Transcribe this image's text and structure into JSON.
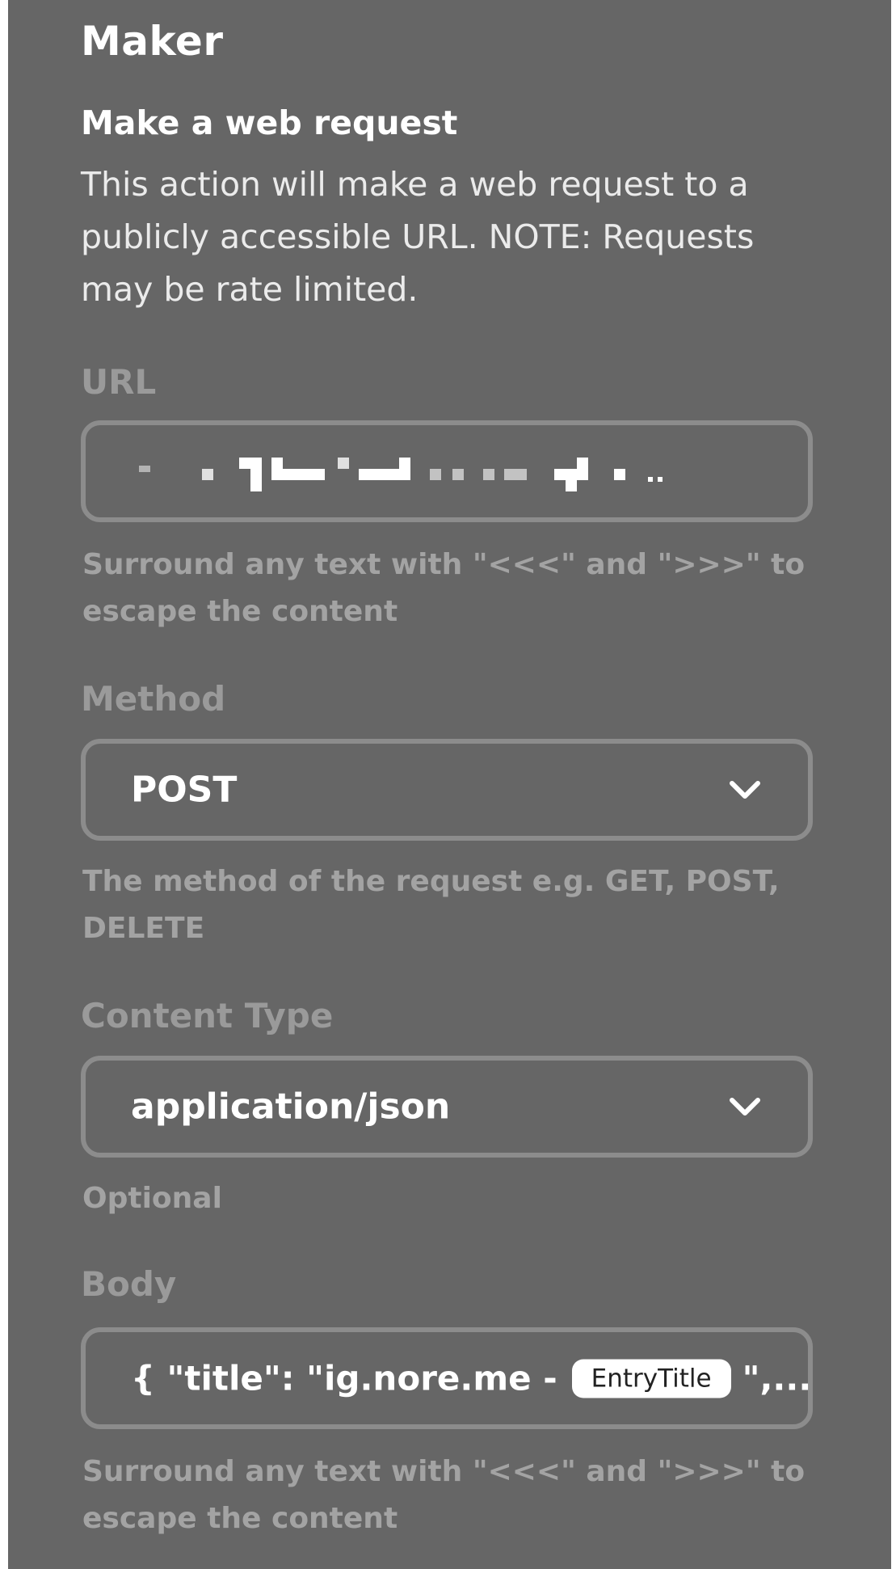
{
  "service": {
    "name": "Maker"
  },
  "action": {
    "title": "Make a web request",
    "description": "This action will make a web request to a publicly accessible URL. NOTE: Requests may be rate limited."
  },
  "fields": {
    "url": {
      "label": "URL",
      "value_state": "redacted (pixelated)",
      "help": "Surround any text with \"<<<\" and \">>>\" to escape the content"
    },
    "method": {
      "label": "Method",
      "value": "POST",
      "help": "The method of the request e.g. GET, POST, DELETE"
    },
    "content_type": {
      "label": "Content Type",
      "value": "application/json",
      "help": "Optional"
    },
    "body": {
      "label": "Body",
      "prefix": "{ \"title\": \"ig.nore.me -",
      "ingredient": "EntryTitle",
      "suffix": "\",...",
      "help": "Surround any text with \"<<<\" and \">>>\" to escape the content"
    }
  },
  "icons": {
    "method_dropdown": "chevron-down-icon",
    "content_type_dropdown": "chevron-down-icon"
  },
  "colors": {
    "panel_background": "#666666",
    "field_border": "#8c8c8c",
    "label_muted": "#9a9a9a",
    "text_primary": "#ffffff"
  }
}
